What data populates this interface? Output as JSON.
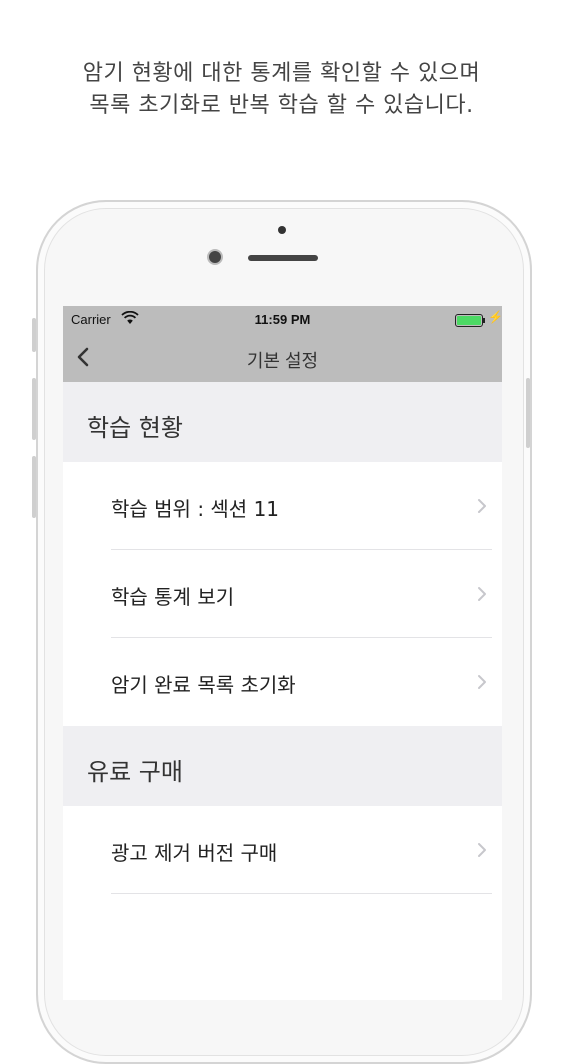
{
  "caption": {
    "line1": "암기 현황에 대한 통계를 확인할 수 있으며",
    "line2": "목록 초기화로 반복 학습 할 수 있습니다."
  },
  "status_bar": {
    "carrier": "Carrier",
    "time": "11:59 PM",
    "wifi_icon": "wifi-icon",
    "battery_icon": "battery-icon",
    "battery_level": 1.0,
    "battery_color": "#4cd964"
  },
  "nav": {
    "back_icon": "chevron-left-icon",
    "title": "기본 설정"
  },
  "sections": [
    {
      "header": "학습 현황",
      "rows": [
        {
          "label": "학습 범위 : 섹션 11"
        },
        {
          "label": "학습 통계 보기"
        },
        {
          "label": "암기 완료 목록 초기화"
        }
      ]
    },
    {
      "header": "유료 구매",
      "rows": [
        {
          "label": "광고 제거 버전 구매"
        }
      ]
    }
  ],
  "colors": {
    "navbar_bg": "#bcbcbc",
    "section_bg": "#efeff2",
    "chevron": "#c7c7cc"
  }
}
